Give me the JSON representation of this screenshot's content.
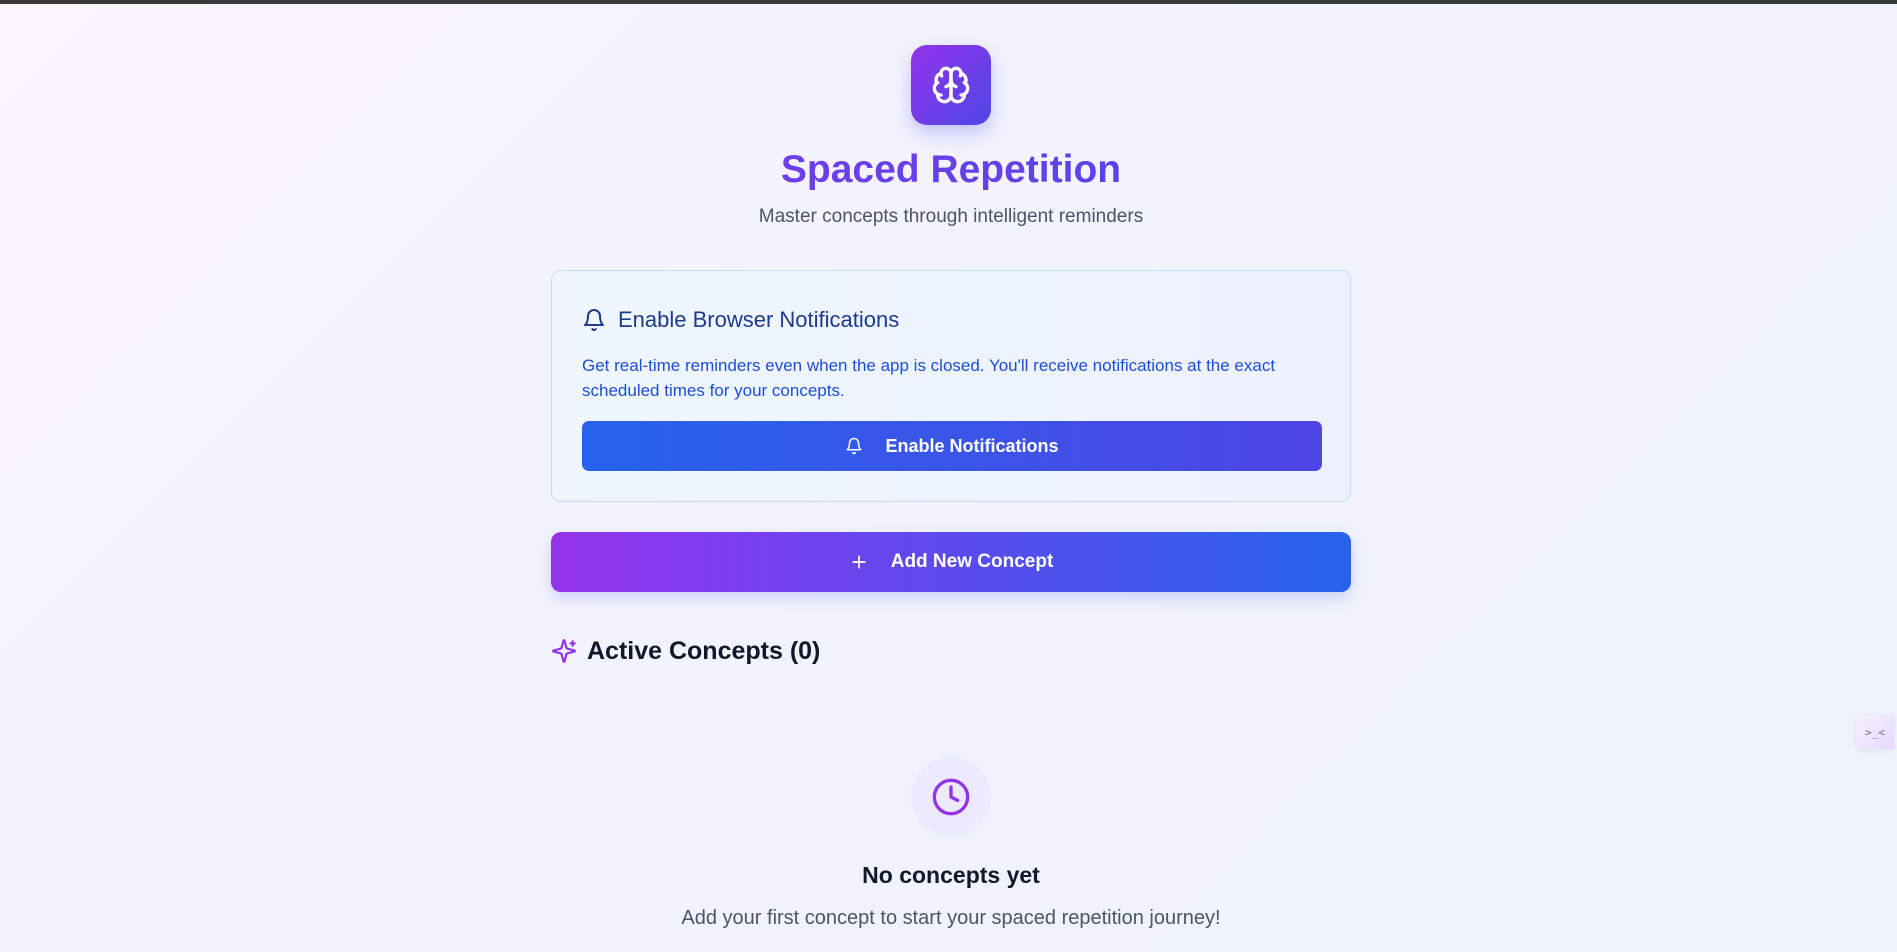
{
  "header": {
    "logo_icon": "brain-icon",
    "title": "Spaced Repetition",
    "subtitle": "Master concepts through intelligent reminders"
  },
  "notifications_card": {
    "icon": "bell-icon",
    "title": "Enable Browser Notifications",
    "description": "Get real-time reminders even when the app is closed. You'll receive notifications at the exact scheduled times for your concepts.",
    "button_icon": "bell-icon",
    "button_label": "Enable Notifications"
  },
  "add_concept": {
    "icon": "plus-icon",
    "label": "Add New Concept"
  },
  "active_concepts": {
    "icon": "sparkles-icon",
    "title": "Active Concepts (0)"
  },
  "empty_state": {
    "icon": "clock-icon",
    "title": "No concepts yet",
    "description": "Add your first concept to start your spaced repetition journey!"
  },
  "side_widget": {
    "label": ">_<"
  },
  "colors": {
    "accent_purple": "#9333ea",
    "accent_indigo": "#4f46e5",
    "accent_blue": "#2563eb",
    "notif_title": "#1e3a8a",
    "notif_text": "#1d4ed8"
  }
}
